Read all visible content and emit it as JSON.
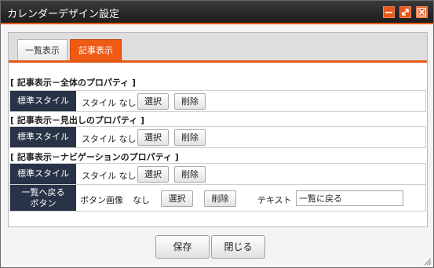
{
  "window": {
    "title": "カレンダーデザイン設定",
    "colors": {
      "accent": "#e15a14",
      "titlebar": "#1c1c1c",
      "label_bg": "#283347"
    }
  },
  "tabs": [
    {
      "label": "一覧表示",
      "active": false
    },
    {
      "label": "記事表示",
      "active": true
    }
  ],
  "sections": [
    {
      "title": "[ 記事表示－全体のプロパティ ]",
      "rows": [
        {
          "label": "標準スタイル",
          "value": "スタイル なし",
          "select_label": "選択",
          "delete_label": "削除"
        }
      ]
    },
    {
      "title": "[ 記事表示－見出しのプロパティ ]",
      "rows": [
        {
          "label": "標準スタイル",
          "value": "スタイル なし",
          "select_label": "選択",
          "delete_label": "削除"
        }
      ]
    },
    {
      "title": "[ 記事表示－ナビゲーションのプロパティ ]",
      "rows": [
        {
          "label": "標準スタイル",
          "value": "スタイル なし",
          "select_label": "選択",
          "delete_label": "削除"
        },
        {
          "label_line1": "一覧へ戻る",
          "label_line2": "ボタン",
          "image_label": "ボタン画像",
          "image_value": "なし",
          "select_label": "選択",
          "delete_label": "削除",
          "text_label": "テキスト",
          "text_value": "一覧に戻る"
        }
      ]
    }
  ],
  "footer": {
    "save_label": "保存",
    "close_label": "閉じる"
  },
  "icons": {
    "minimize": "minimize-icon",
    "maximize": "maximize-icon",
    "close": "close-icon",
    "resize": "resize-grip-icon"
  }
}
